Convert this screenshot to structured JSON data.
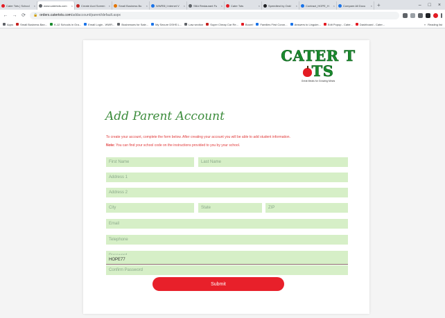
{
  "browser": {
    "tabs": [
      {
        "title": "Cater Tots | School",
        "color": "#e31b23"
      },
      {
        "title": "www.catertots.com",
        "color": "#5f6368",
        "active": true
      },
      {
        "title": "Create Acct Screen",
        "color": "#c5221f"
      },
      {
        "title": "Small Business Bu",
        "color": "#e37400"
      },
      {
        "title": "WWRB | Internet V",
        "color": "#1a73e8"
      },
      {
        "title": "SBA Restaurant Fu",
        "color": "#5f6368"
      },
      {
        "title": "Cater Tots",
        "color": "#e31b23"
      },
      {
        "title": "Speedtest by Ookl",
        "color": "#202124"
      },
      {
        "title": "Contract_HOPE_H",
        "color": "#1a73e8"
      },
      {
        "title": "Compare All Docu",
        "color": "#1a73e8"
      }
    ],
    "new_tab": "+",
    "window_controls": {
      "minimize": "–",
      "maximize": "□",
      "close": "×"
    },
    "url_domain": "orders.catertots.com",
    "url_path": "/addaccount/parent/default.aspx",
    "bookmarks": [
      {
        "label": "Apps",
        "color": "#5f6368"
      },
      {
        "label": "Small Business Ban...",
        "color": "#c5221f"
      },
      {
        "label": "K-12 Schools in Ora...",
        "color": "#1a8a2e"
      },
      {
        "label": "Email Login - WWR...",
        "color": "#1a73e8"
      },
      {
        "label": "Businesses for Sale...",
        "color": "#5f6368"
      },
      {
        "label": "My Secure DSHS L...",
        "color": "#1a73e8"
      },
      {
        "label": "Law section",
        "color": "#5f6368"
      },
      {
        "label": "Super Cheap Car Re...",
        "color": "#c5221f"
      },
      {
        "label": "Boom!",
        "color": "#e31b23"
      },
      {
        "label": "Families First Coron...",
        "color": "#1a73e8"
      },
      {
        "label": "Answers to Linguim...",
        "color": "#1a73e8"
      },
      {
        "label": "Edit Popup - Cater...",
        "color": "#e31b23"
      },
      {
        "label": "Dashboard - Cater...",
        "color": "#e31b23"
      }
    ],
    "bookmarks_more": "»",
    "reading_list": "Reading list"
  },
  "logo": {
    "brand_part1": "CATER T",
    "brand_part2": "TS",
    "tagline": "Great Meals for Growing Minds"
  },
  "form": {
    "title": "Add Parent Account",
    "intro": "To create your account, complete the form below. After creating your account you will be able to add student information.",
    "note_label": "Note:",
    "note_text": " You can find your school code on the instructions provided to you by your school.",
    "placeholders": {
      "first_name": "First Name",
      "last_name": "Last Name",
      "address1": "Address 1",
      "address2": "Address 2",
      "city": "City",
      "state": "State",
      "zip": "ZIP",
      "email": "Email",
      "telephone": "Telephone",
      "password": "Password",
      "confirm_password": "Confirm Password"
    },
    "school_code_value": "HOPE77",
    "submit_label": "Submit"
  },
  "colors": {
    "field_bg": "#d6efc7",
    "accent_red": "#e8202a",
    "heading_green": "#3c8c3c",
    "logo_green": "#1a8a2e"
  }
}
